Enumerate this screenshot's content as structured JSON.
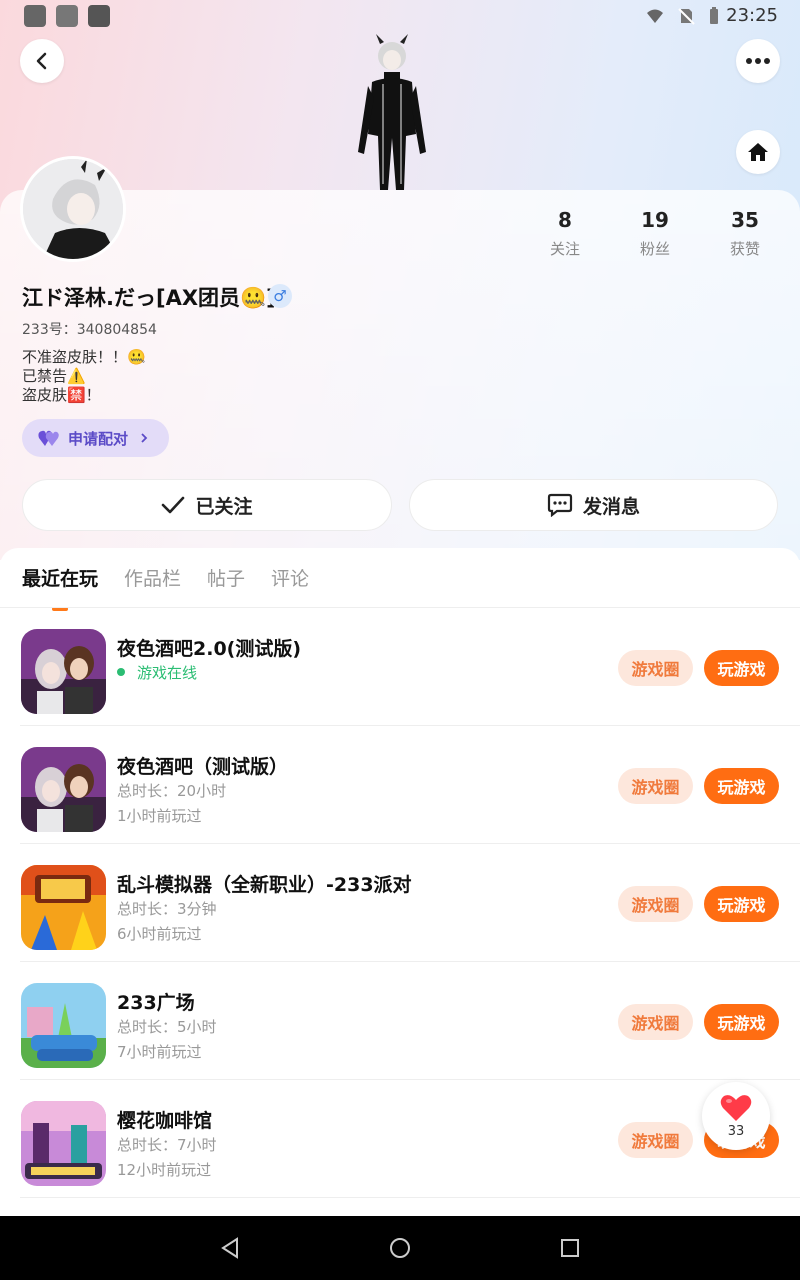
{
  "status_bar": {
    "time": "23:25"
  },
  "profile": {
    "stats": [
      {
        "value": "8",
        "label": "关注"
      },
      {
        "value": "19",
        "label": "粉丝"
      },
      {
        "value": "35",
        "label": "获赞"
      }
    ],
    "nickname": "江ド泽林.だっ[AX团员🤐]",
    "gender_symbol": "♂",
    "uid": "233号：340804854",
    "bio_lines": [
      "不准盗皮肤！！🤐",
      "已禁告⚠️",
      "盗皮肤🈲！"
    ],
    "pair_label": "申请配对",
    "follow_label": "已关注",
    "message_label": "发消息"
  },
  "tabs": [
    "最近在玩",
    "作品栏",
    "帖子",
    "评论"
  ],
  "games": [
    {
      "title": "夜色酒吧2.0(测试版)",
      "line1": "游戏在线",
      "line2": "",
      "online": true,
      "circle": "游戏圈",
      "play": "玩游戏"
    },
    {
      "title": "夜色酒吧（测试版）",
      "line1": "总时长：20小时",
      "line2": "1小时前玩过",
      "online": false,
      "circle": "游戏圈",
      "play": "玩游戏"
    },
    {
      "title": "乱斗模拟器（全新职业）-233派对",
      "line1": "总时长：3分钟",
      "line2": "6小时前玩过",
      "online": false,
      "circle": "游戏圈",
      "play": "玩游戏"
    },
    {
      "title": "233广场",
      "line1": "总时长：5小时",
      "line2": "7小时前玩过",
      "online": false,
      "circle": "游戏圈",
      "play": "玩游戏"
    },
    {
      "title": "樱花咖啡馆",
      "line1": "总时长：7小时",
      "line2": "12小时前玩过",
      "online": false,
      "circle": "游戏圈",
      "play": "玩游戏"
    }
  ],
  "like_count": "33",
  "colors": {
    "accent": "#ff6d12",
    "circle_bg": "#fde7dc",
    "online": "#2bbd73",
    "pair": "#5b4bc7"
  }
}
